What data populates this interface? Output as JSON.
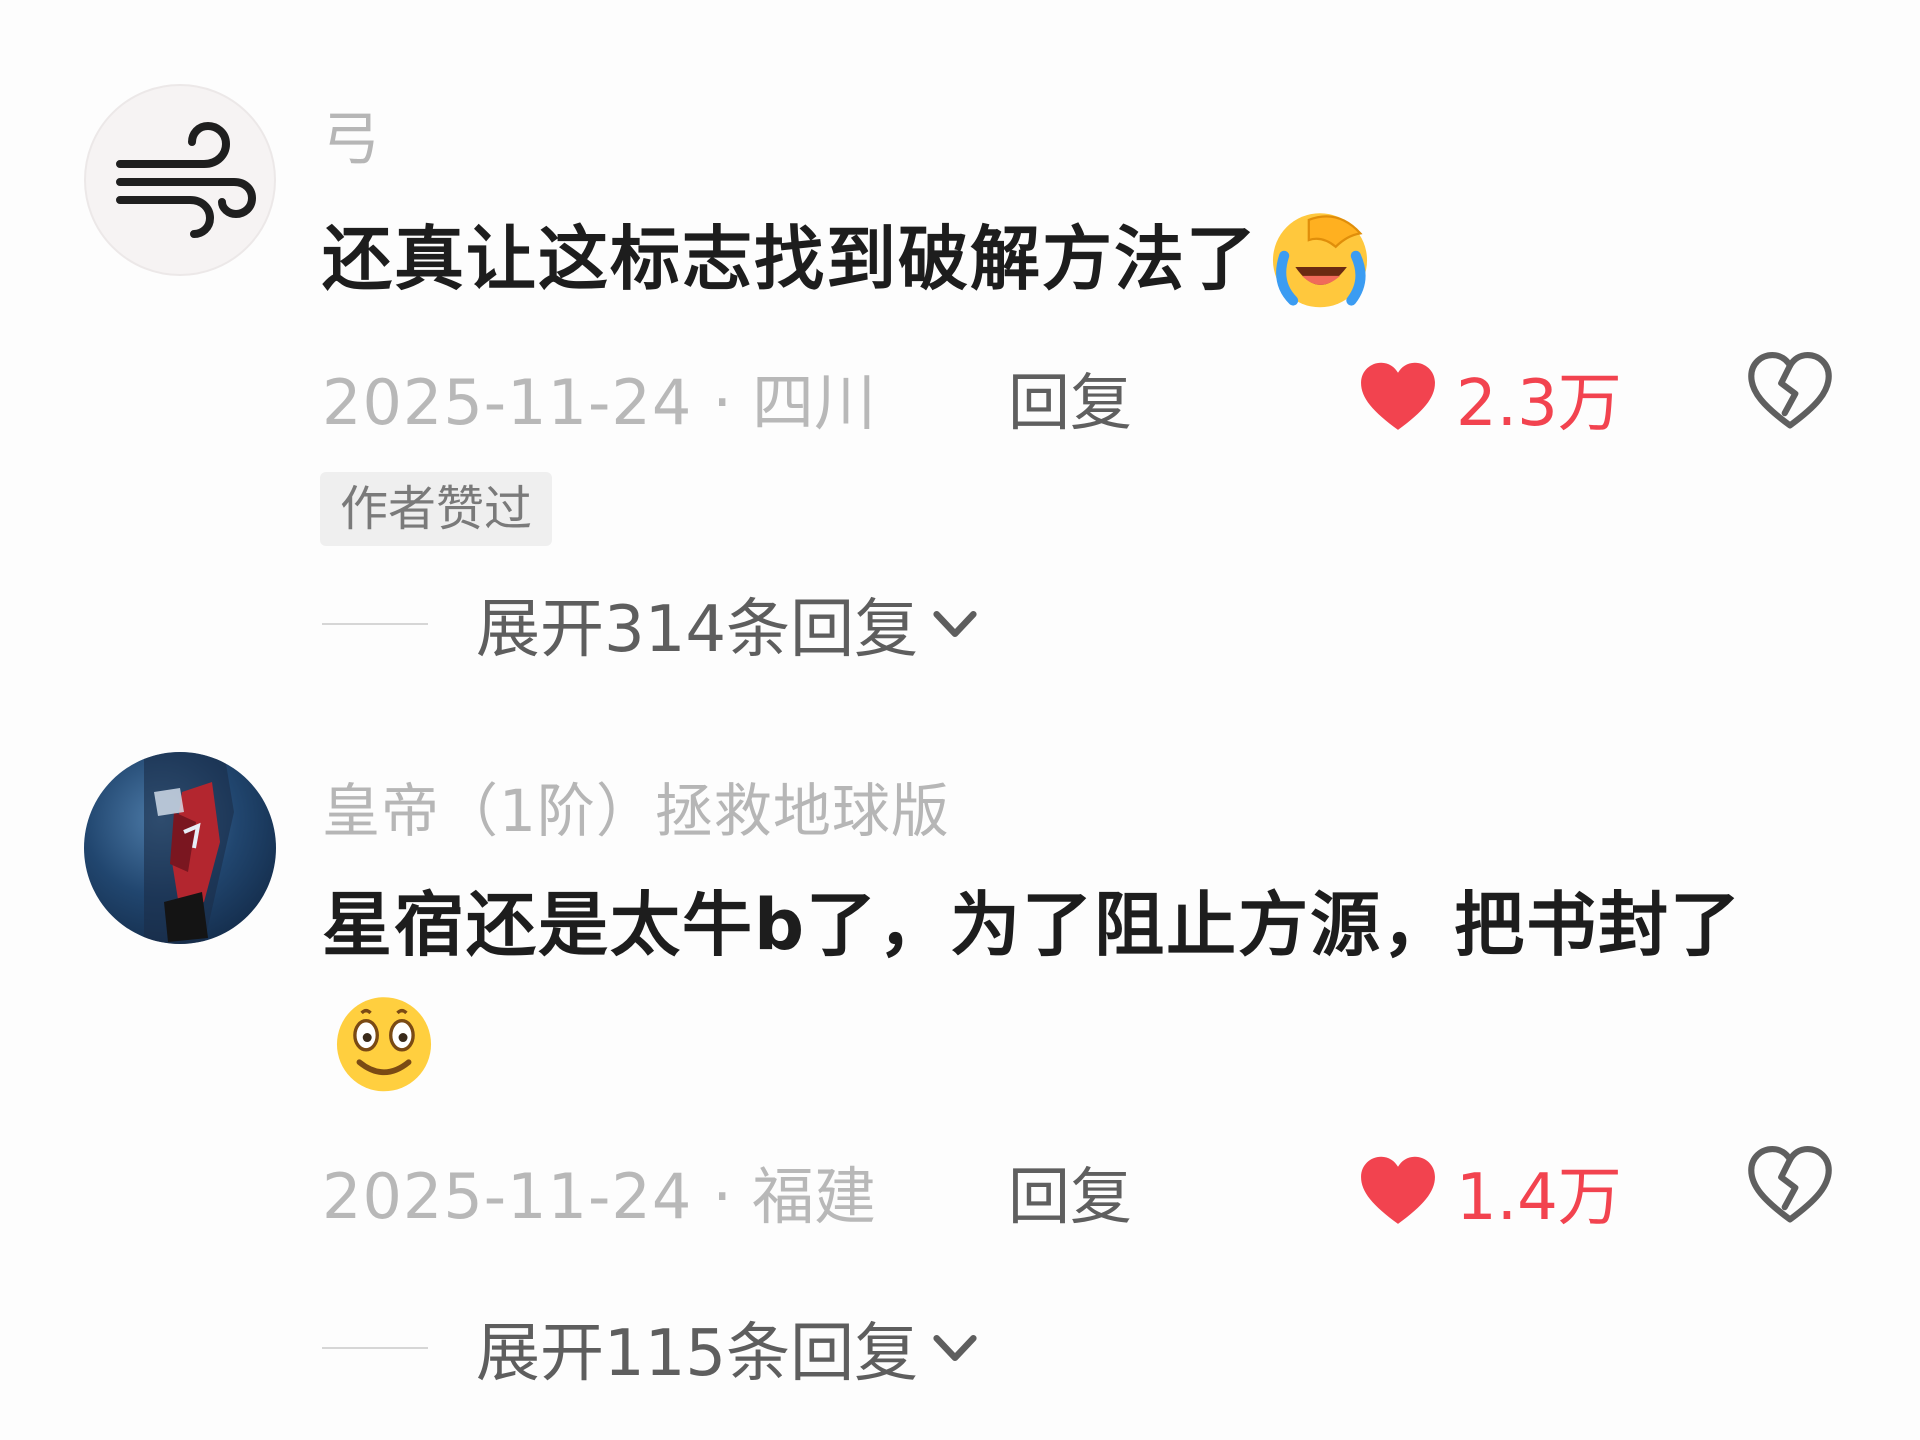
{
  "comments": [
    {
      "username": "弓",
      "avatar_icon": "wind-icon",
      "text": "还真让这标志找到破解方法了",
      "emoji": "face-with-tears-of-joy",
      "date": "2025-11-24",
      "separator": "·",
      "location": "四川",
      "reply_label": "回复",
      "likes": "2.3万",
      "liked": true,
      "author_liked_tag": "作者赞过",
      "expand_label": "展开314条回复"
    },
    {
      "username": "皇帝（1阶）拯救地球版",
      "avatar_icon": "character-avatar",
      "text": "星宿还是太牛b了，为了阻止方源，把书封了",
      "emoji": "smiling-face",
      "date": "2025-11-24",
      "separator": "·",
      "location": "福建",
      "reply_label": "回复",
      "likes": "1.4万",
      "liked": true,
      "expand_label": "展开115条回复"
    }
  ],
  "colors": {
    "like_red": "#f2434f",
    "muted_text": "#b8b8b8",
    "body_text": "#1d1d1d"
  }
}
